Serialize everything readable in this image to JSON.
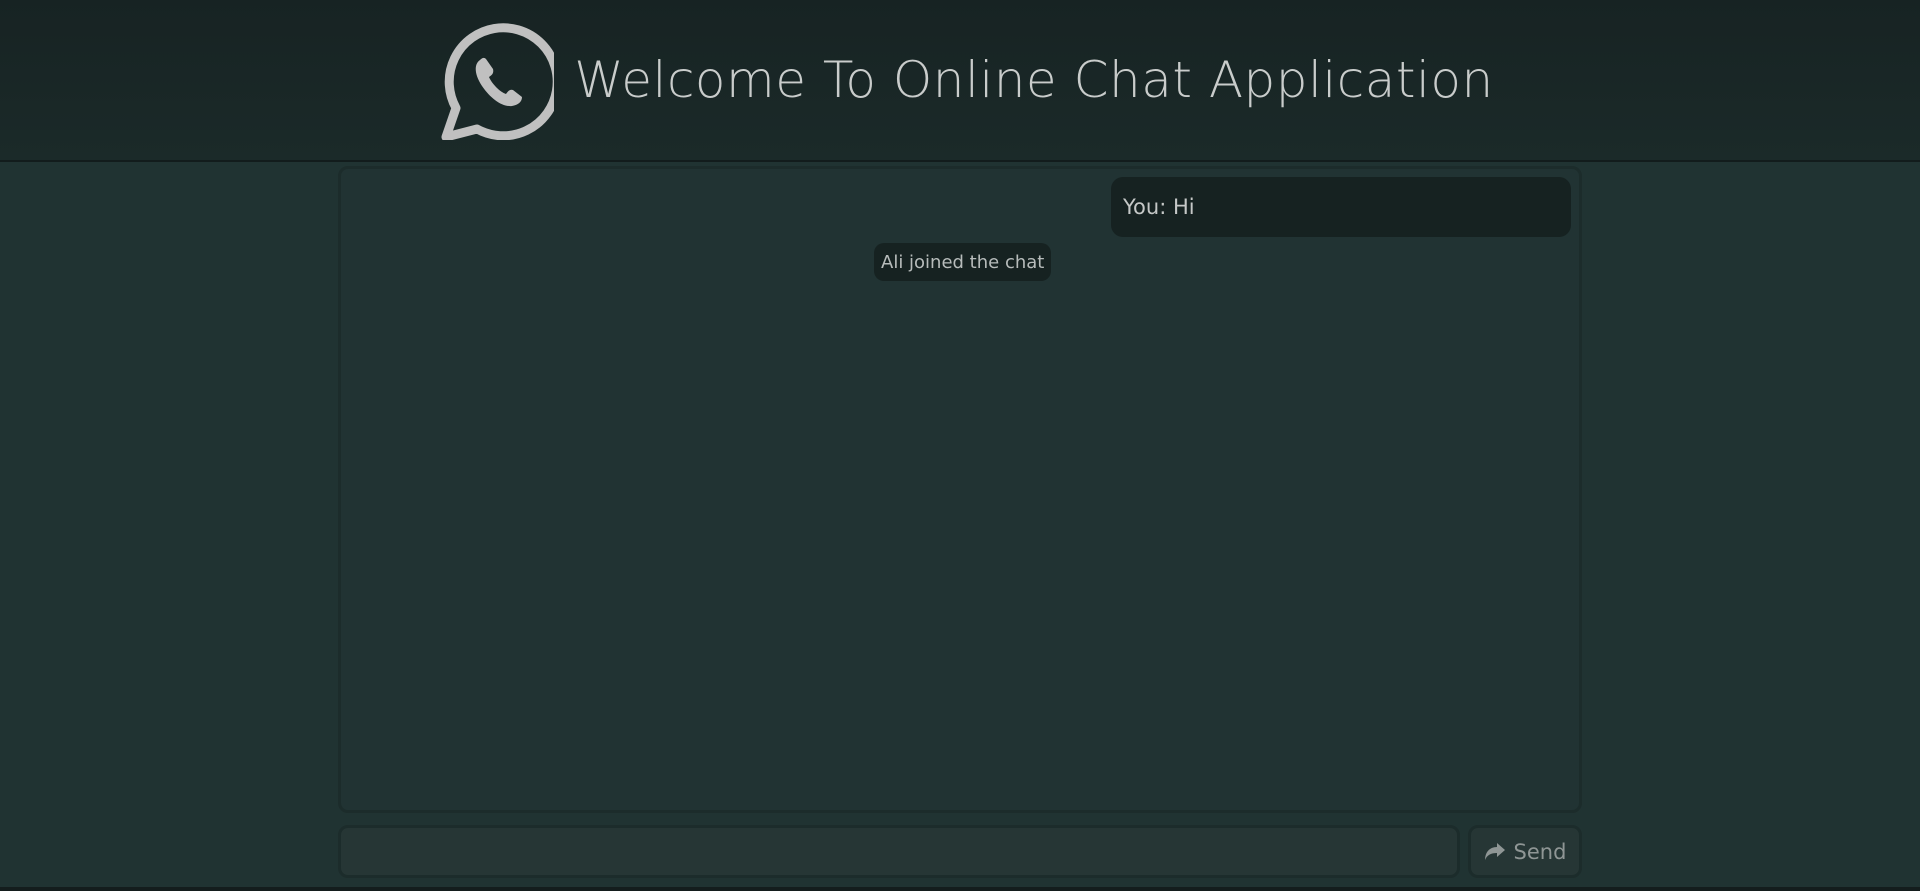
{
  "header": {
    "title": "Welcome To Online Chat Application",
    "logo_icon": "whatsapp-logo-icon"
  },
  "messages": [
    {
      "type": "own",
      "text": "You: Hi"
    }
  ],
  "notices": [
    {
      "text": "Ali joined the chat"
    }
  ],
  "composer": {
    "value": "",
    "placeholder": "",
    "send_label": "Send",
    "send_icon": "share-arrow-icon"
  },
  "colors": {
    "page_bg": "#203332",
    "header_bg": "#172323",
    "bubble_bg": "#162221",
    "text": "#c9cccb"
  }
}
